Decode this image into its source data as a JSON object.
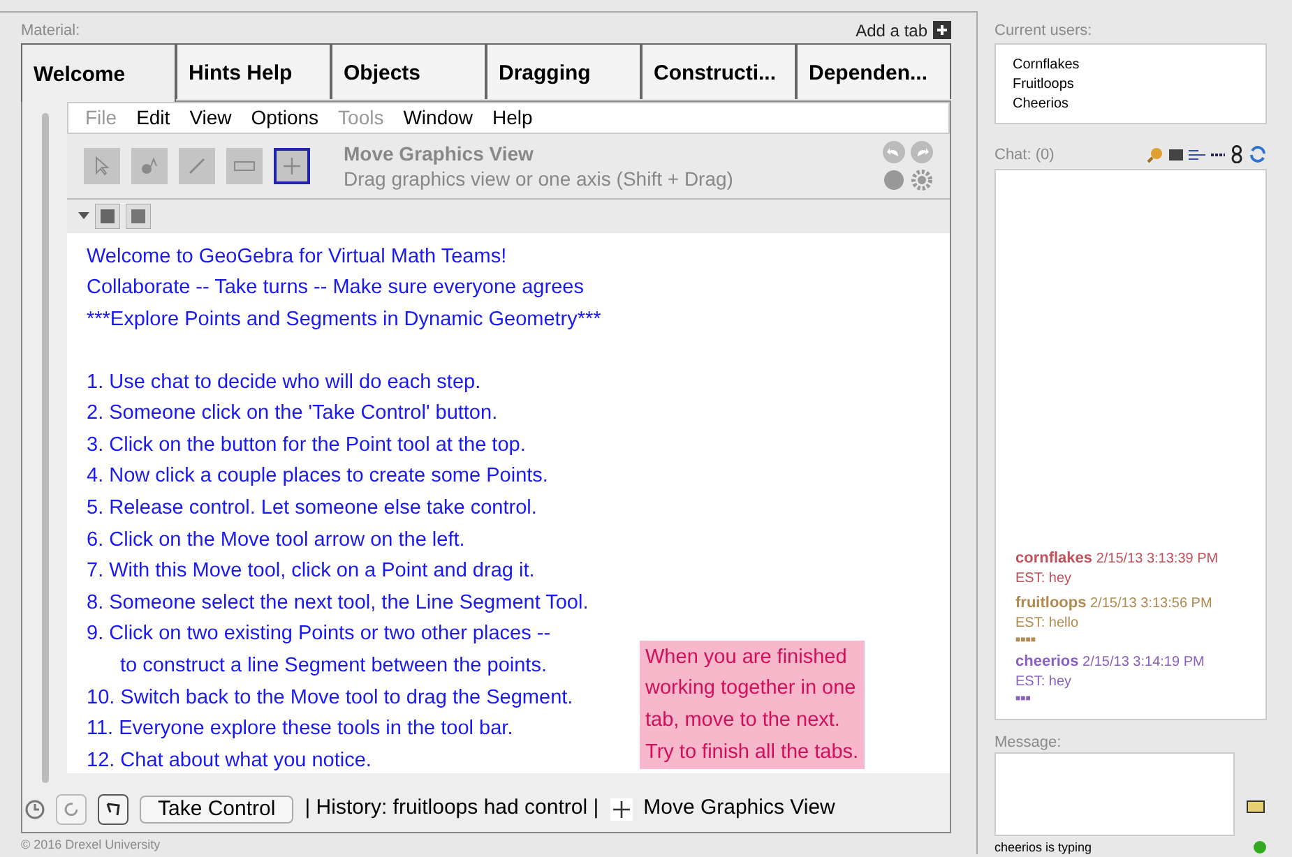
{
  "material_label": "Material:",
  "add_tab": "Add a tab",
  "tabs": [
    {
      "label": "Welcome",
      "selected": true
    },
    {
      "label": "Hints Help",
      "selected": false
    },
    {
      "label": "Objects",
      "selected": false
    },
    {
      "label": "Dragging",
      "selected": false
    },
    {
      "label": "Constructi...",
      "selected": false
    },
    {
      "label": "Dependen...",
      "selected": false
    }
  ],
  "menu": [
    {
      "label": "File",
      "disabled": true
    },
    {
      "label": "Edit",
      "disabled": false
    },
    {
      "label": "View",
      "disabled": false
    },
    {
      "label": "Options",
      "disabled": false
    },
    {
      "label": "Tools",
      "disabled": true
    },
    {
      "label": "Window",
      "disabled": false
    },
    {
      "label": "Help",
      "disabled": false
    }
  ],
  "tools": [
    {
      "kind": "pointer",
      "selected": false
    },
    {
      "kind": "point",
      "selected": false
    },
    {
      "kind": "segment",
      "selected": false
    },
    {
      "kind": "text",
      "selected": false
    },
    {
      "kind": "move",
      "selected": true
    }
  ],
  "tool_title": "Move Graphics View",
  "tool_help": "Drag graphics view or one axis (Shift + Drag)",
  "intro": [
    "Welcome to GeoGebra for Virtual Math Teams!",
    "Collaborate -- Take turns -- Make sure everyone agrees",
    "***Explore Points and Segments in Dynamic Geometry***"
  ],
  "steps": [
    {
      "text": "1. Use chat to decide who will do each step."
    },
    {
      "text": "2. Someone click on the 'Take Control' button."
    },
    {
      "text": "3. Click on the button for the Point tool at the top."
    },
    {
      "text": "4. Now click a couple places to create some Points."
    },
    {
      "text": "5. Release control. Let someone else take control."
    },
    {
      "text": "6. Click on the Move tool arrow on the left."
    },
    {
      "text": "7. With this Move tool, click on a Point and drag it."
    },
    {
      "text": "8. Someone select the next tool, the Line Segment Tool."
    },
    {
      "text": "9. Click on two existing Points or two other places --",
      "continuation": "to construct a line Segment between the points."
    },
    {
      "text": "10. Switch back to the Move tool to drag the Segment."
    },
    {
      "text": "11. Everyone explore these tools in the tool bar."
    },
    {
      "text": "12. Chat about what you notice."
    }
  ],
  "note": [
    "When you are finished",
    "working together in one",
    "tab, move to the next.",
    "Try to finish all the tabs."
  ],
  "take_control": "Take Control",
  "history": "| History: fruitloops had control |",
  "current_tool": "Move Graphics View",
  "copyright": "© 2016 Drexel University",
  "users_label": "Current users:",
  "users": [
    "Cornflakes",
    "Fruitloops",
    "Cheerios"
  ],
  "chat_label": "Chat: (0)",
  "messages": [
    {
      "user": "cornflakes",
      "time": "2/15/13 3:13:39 PM",
      "text": "EST: hey",
      "color": "#c0505a"
    },
    {
      "user": "fruitloops",
      "time": "2/15/13 3:13:56 PM",
      "text": "EST: hello",
      "color": "#b08a50",
      "marks": "■■■■"
    },
    {
      "user": "cheerios",
      "time": "2/15/13 3:14:19 PM",
      "text": "EST: hey",
      "color": "#8a60c0",
      "marks": "■■■"
    }
  ],
  "message_label": "Message:",
  "typing": "cheerios is typing",
  "online": true
}
